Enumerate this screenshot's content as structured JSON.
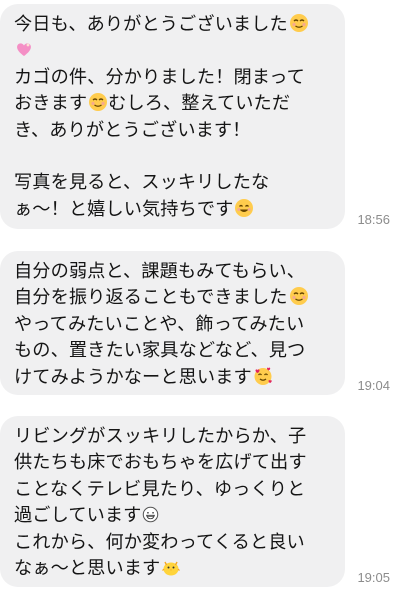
{
  "messages": [
    {
      "lines": [
        {
          "text": "今日も、ありがとうございました",
          "emoji": "relieved-face-icon"
        },
        {
          "text": "",
          "emoji": "sparkling-heart-icon"
        },
        {
          "text": "カゴの件、分かりました！閉まって",
          "emoji": ""
        },
        {
          "text": "おきます",
          "emoji": "relieved-face-icon",
          "after": "むしろ、整えていただ"
        },
        {
          "text": "き、ありがとうございます！",
          "emoji": ""
        },
        {
          "text": "",
          "emoji": ""
        },
        {
          "text": "写真を見ると、スッキリしたな",
          "emoji": ""
        },
        {
          "text": "ぁ〜！と嬉しい気持ちです",
          "emoji": "smiling-face-icon"
        }
      ],
      "time": "18:56"
    },
    {
      "lines": [
        {
          "text": "自分の弱点と、課題もみてもらい、",
          "emoji": ""
        },
        {
          "text": "自分を振り返ることもできました",
          "emoji": "relieved-face-icon"
        },
        {
          "text": "やってみたいことや、飾ってみたい",
          "emoji": ""
        },
        {
          "text": "もの、置きたい家具などなど、見つ",
          "emoji": ""
        },
        {
          "text": "けてみようかなーと思います",
          "emoji": "smiling-hearts-face-icon"
        }
      ],
      "time": "19:04"
    },
    {
      "lines": [
        {
          "text": "リビングがスッキリしたからか、子",
          "emoji": ""
        },
        {
          "text": "供たちも床でおもちゃを広げて出す",
          "emoji": ""
        },
        {
          "text": "ことなくテレビ見たり、ゆっくりと",
          "emoji": ""
        },
        {
          "text": "過ごしています",
          "emoji": "grinning-face-icon"
        },
        {
          "text": "これから、何か変わってくると良い",
          "emoji": ""
        },
        {
          "text": "なぁ〜と思います",
          "emoji": "chick-icon"
        }
      ],
      "time": "19:05"
    }
  ],
  "colors": {
    "bubble": "#f0f0f1",
    "text": "#151515",
    "time": "#8c8c8c"
  }
}
